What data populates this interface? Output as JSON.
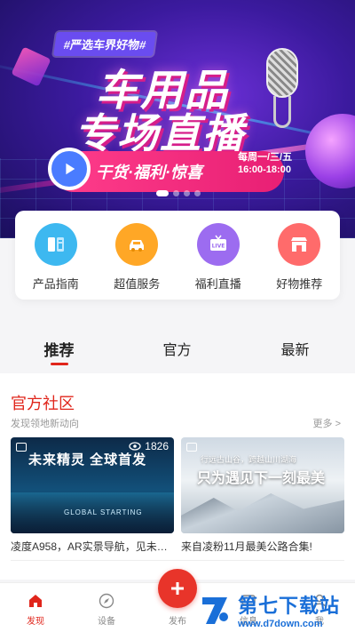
{
  "banner": {
    "hashtag": "#严选车界好物#",
    "headline_line1": "车用品",
    "headline_line2": "专场直播",
    "tagline": "干货·福利·惊喜",
    "schedule_days": "每周一/三/五",
    "schedule_time": "16:00-18:00",
    "carousel_count": 4,
    "carousel_active": 0
  },
  "quick_menu": [
    {
      "label": "产品指南",
      "icon": "book-icon",
      "color": "#3db8f0"
    },
    {
      "label": "超值服务",
      "icon": "car-icon",
      "color": "#ffa726"
    },
    {
      "label": "福利直播",
      "icon": "live-tv-icon",
      "color": "#9c6cf0"
    },
    {
      "label": "好物推荐",
      "icon": "store-icon",
      "color": "#ff6b6b"
    }
  ],
  "tabs": [
    {
      "label": "推荐",
      "active": true
    },
    {
      "label": "官方",
      "active": false
    },
    {
      "label": "最新",
      "active": false
    }
  ],
  "section": {
    "title": "官方社区",
    "subtitle": "发现领地新动向",
    "more": "更多 >"
  },
  "cards": [
    {
      "views": "1826",
      "headline": "未来精灵 全球首发",
      "subline": "GLOBAL STARTING",
      "caption": "凌度A958，AR实景导航，见未来..."
    },
    {
      "small_text": "行远古山谷，跨越山川湖海",
      "headline": "只为遇见下一刻最美",
      "caption": "来自凌粉11月最美公路合集!"
    }
  ],
  "bottom_nav": [
    {
      "label": "发现",
      "icon": "home-icon",
      "active": true
    },
    {
      "label": "设备",
      "icon": "compass-icon",
      "active": false
    },
    {
      "label": "发布",
      "icon": "plus-icon",
      "active": false
    },
    {
      "label": "信息",
      "icon": "message-icon",
      "active": false
    },
    {
      "label": "我",
      "icon": "user-icon",
      "active": false
    }
  ],
  "watermark": {
    "title": "第七下载站",
    "url": "www.d7down.com"
  },
  "colors": {
    "accent": "#e0251b",
    "banner_pink": "#e81f74"
  }
}
